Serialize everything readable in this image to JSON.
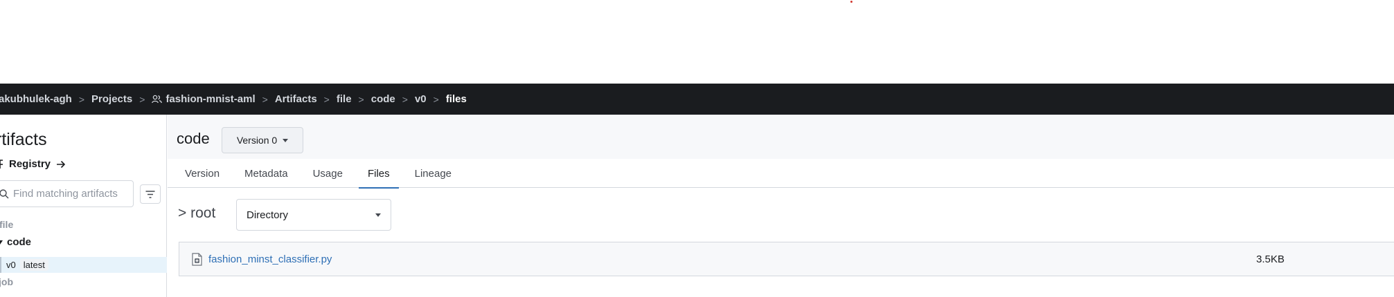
{
  "breadcrumb": {
    "items": [
      {
        "label": "akubhulek-agh",
        "icon": null
      },
      {
        "label": "Projects",
        "icon": null
      },
      {
        "label": "fashion-mnist-aml",
        "icon": "users-icon"
      },
      {
        "label": "Artifacts",
        "icon": null
      },
      {
        "label": "file",
        "icon": null
      },
      {
        "label": "code",
        "icon": null
      },
      {
        "label": "v0",
        "icon": null
      },
      {
        "label": "files",
        "icon": null
      }
    ],
    "separator": ">"
  },
  "sidebar": {
    "title": "rtifacts",
    "registry_label": "Registry",
    "search_placeholder": "Find matching artifacts",
    "tree": {
      "type_file": "file",
      "artifact_code": "code",
      "version": "v0",
      "alias": "latest",
      "type_job": "job"
    }
  },
  "header": {
    "artifact_name": "code",
    "version_button": "Version 0"
  },
  "tabs": [
    "Version",
    "Metadata",
    "Usage",
    "Files",
    "Lineage"
  ],
  "active_tab": "Files",
  "files_view": {
    "root_label": "> root",
    "directory_select": "Directory",
    "files": [
      {
        "name": "fashion_minst_classifier.py",
        "size": "3.5KB"
      }
    ]
  },
  "colors": {
    "topbar": "#1a1c1f",
    "link": "#2e6fb5",
    "selected_row": "#e7f3fb"
  }
}
